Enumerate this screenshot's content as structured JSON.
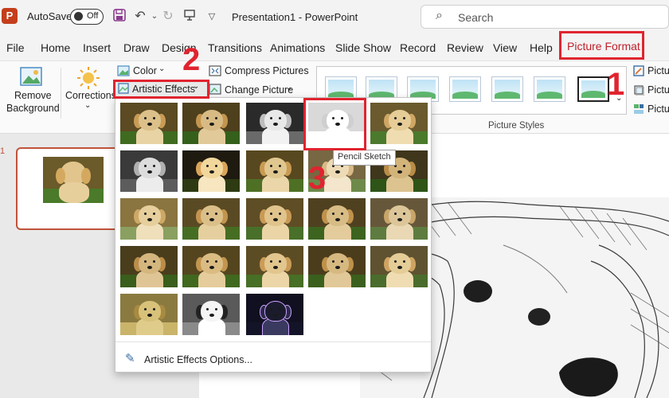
{
  "titlebar": {
    "app_icon": "powerpoint-icon",
    "app_icon_letter": "P",
    "autosave_label": "AutoSave",
    "autosave_state": "Off",
    "doc_title": "Presentation1  -  PowerPoint",
    "search_placeholder": "Search"
  },
  "tabs": [
    "File",
    "Home",
    "Insert",
    "Draw",
    "Design",
    "Transitions",
    "Animations",
    "Slide Show",
    "Record",
    "Review",
    "View",
    "Help"
  ],
  "active_tab": "Picture Format",
  "ribbon": {
    "remove_background": [
      "Remove",
      "Background"
    ],
    "corrections": "Corrections",
    "color": "Color",
    "artistic_effects": "Artistic Effects",
    "compress_pictures": "Compress Pictures",
    "change_picture": "Change Picture",
    "picture_styles_label": "Picture Styles",
    "right_items": [
      "Pictur",
      "Pictur",
      "Pictur"
    ]
  },
  "artistic_effects_menu": {
    "effects_count": 23,
    "hovered_tooltip": "Pencil Sketch",
    "footer_option": "Artistic Effects Options..."
  },
  "annotations": {
    "step1": "1",
    "step2": "2",
    "step3": "3",
    "highlight_color": "#e0242f"
  },
  "slide_panel": {
    "slide_number": "1"
  }
}
